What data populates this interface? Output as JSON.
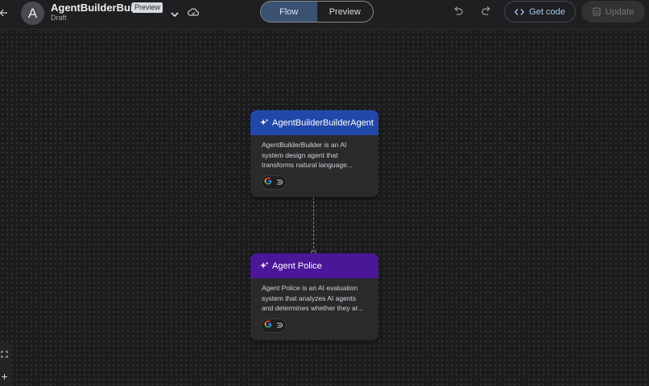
{
  "header": {
    "avatar_letter": "A",
    "title": "AgentBuilderBui...",
    "badge": "Preview",
    "status": "Draft"
  },
  "view_toggle": {
    "flow_label": "Flow",
    "preview_label": "Preview",
    "active": "Flow"
  },
  "actions": {
    "get_code_label": "Get code",
    "update_label": "Update"
  },
  "nodes": [
    {
      "title": "AgentBuilderBuilderAgent",
      "header_color": "#2148a8",
      "description": "AgentBuilderBuilder is an AI system design agent that transforms natural language..."
    },
    {
      "title": "Agent Police",
      "header_color": "#4c1699",
      "description": "Agent Police is an AI evaluation system that analyzes AI agents and determines whether they ar..."
    }
  ],
  "colors": {
    "accent_blue": "#a8c5f0",
    "background": "#1c1c1e"
  },
  "icons": [
    "back-arrow-icon",
    "chevron-down-icon",
    "cloud-icon",
    "undo-icon",
    "redo-icon",
    "code-icon",
    "upload-icon",
    "sparkle-icon",
    "google-icon",
    "connector-icon",
    "fit-view-icon",
    "zoom-in-icon"
  ]
}
